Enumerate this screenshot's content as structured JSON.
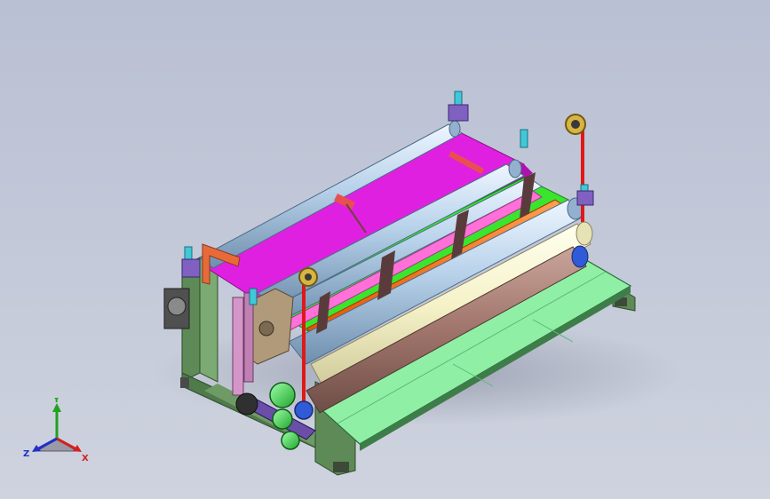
{
  "triad": {
    "x_label": "X",
    "y_label": "Y",
    "z_label": "Z",
    "x_color": "#d42020",
    "y_color": "#1fa31f",
    "z_color": "#2030c8"
  },
  "colors": {
    "background_top": "#b9c0d3",
    "background_bottom": "#cfd3df",
    "frame": "#5d8a56",
    "magenta_web": "#e020e0",
    "green_web": "#39e62d",
    "orange_roller": "#ff6a00",
    "cream_roller": "#f5f2c8",
    "brown_roller": "#a0756b",
    "table_top": "#8ff0a5",
    "steel_roller": "#b8d2ea",
    "belt_pulley": "#48e05a",
    "red_rod": "#e01818"
  }
}
